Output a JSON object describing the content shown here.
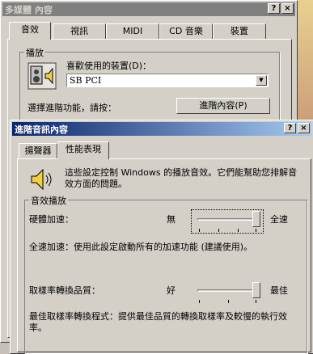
{
  "outer_window": {
    "title": "多媒體 內容",
    "help_btn": "?",
    "close_btn": "×",
    "tabs": [
      "音效",
      "視訊",
      "MIDI",
      "CD 音樂",
      "裝置"
    ],
    "playback_group": "播放",
    "preferred_device_label": "喜歡使用的裝置(D)：",
    "device_value": "SB PCI",
    "advanced_prompt": "選擇進階功能，請按：",
    "advanced_button": "進階內容(P)"
  },
  "inner_window": {
    "title": "進階音訊內容",
    "help_btn": "?",
    "close_btn": "×",
    "tabs": [
      "揚聲器",
      "性能表現"
    ],
    "description": "這些設定控制 Windows 的播放音效。它們能幫助您排解音效方面的問題。",
    "group_title": "音效播放",
    "hw_accel": {
      "label": "硬體加速：",
      "min_label": "無",
      "max_label": "全速",
      "level": 1.0,
      "desc": "全速加速：使用此設定啟動所有的加速功能 (建議使用)。"
    },
    "src_quality": {
      "label": "取樣率轉換品質：",
      "min_label": "好",
      "max_label": "最佳",
      "level": 1.0,
      "desc": "最佳取樣率轉換程式：提供最佳品質的轉換取樣率及較慢的執行效率。"
    }
  },
  "colors": {
    "active_title_start": "#0a246a",
    "active_title_end": "#a6caf0",
    "inactive_title": "#808080",
    "face": "#d4d0c8"
  }
}
